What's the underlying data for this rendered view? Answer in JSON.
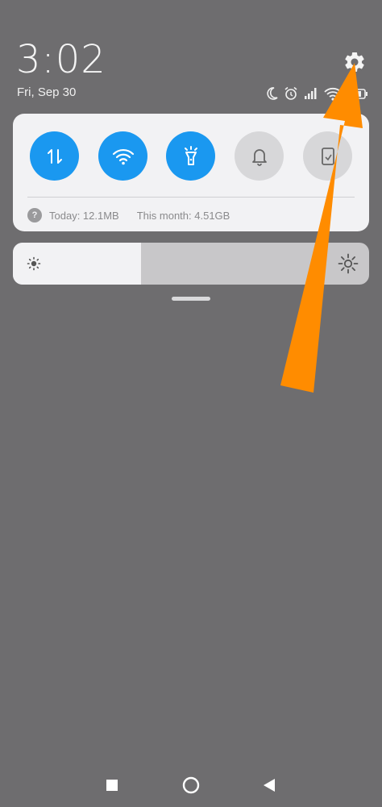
{
  "header": {
    "time": "3:02",
    "date": "Fri, Sep 30"
  },
  "status_icons": [
    "moon-icon",
    "alarm-icon",
    "signal-icon",
    "wifi-icon",
    "battery-icon"
  ],
  "quick_settings": {
    "tiles": [
      {
        "name": "mobile-data",
        "icon": "arrows-up-down-icon",
        "state": "on"
      },
      {
        "name": "wifi",
        "icon": "wifi-icon",
        "state": "on"
      },
      {
        "name": "flashlight",
        "icon": "flashlight-icon",
        "state": "on"
      },
      {
        "name": "sound",
        "icon": "bell-icon",
        "state": "off"
      },
      {
        "name": "screenshot",
        "icon": "screenshot-icon",
        "state": "off"
      }
    ],
    "usage": {
      "help_glyph": "?",
      "today": "Today: 12.1MB",
      "month": "This month: 4.51GB"
    }
  },
  "brightness": {
    "level": 0.36
  },
  "navigation": [
    "recents-button",
    "home-button",
    "back-button"
  ],
  "colors": {
    "background": "#6e6d6f",
    "tile_on": "#1a98f0",
    "tile_off": "#d7d7d9",
    "arrow": "#ff8c00"
  }
}
